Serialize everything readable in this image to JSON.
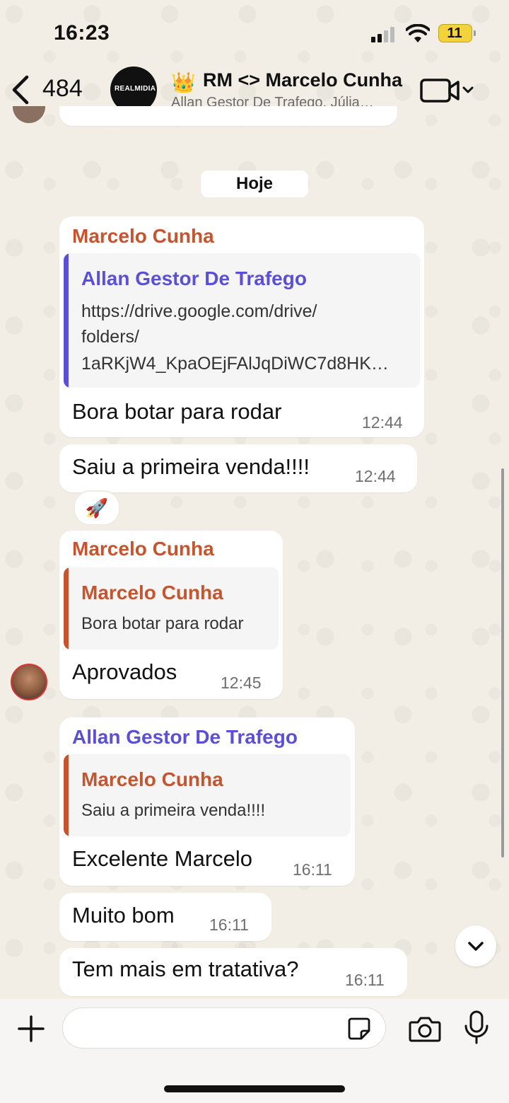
{
  "status_bar": {
    "time": "16:23",
    "battery": "11"
  },
  "header": {
    "back_count": "484",
    "avatar_text": "REALMIDIA",
    "crown": "👑",
    "title": "RM <> Marcelo Cunha",
    "subtitle": "Allan Gestor De Trafego, Júlia…"
  },
  "date_separator": "Hoje",
  "messages": [
    {
      "sender": "Marcelo Cunha",
      "quote_sender": "Allan Gestor De Trafego",
      "quote_lines": [
        "https://drive.google.com/drive/",
        "folders/",
        "1aRKjW4_KpaOEjFAlJqDiWC7d8HK…"
      ],
      "text": "Bora botar para rodar",
      "time": "12:44"
    },
    {
      "text": "Saiu a primeira venda!!!!",
      "time": "12:44",
      "reaction": "🚀"
    },
    {
      "sender": "Marcelo Cunha",
      "quote_sender": "Marcelo Cunha",
      "quote_text": "Bora botar para rodar",
      "text": "Aprovados",
      "time": "12:45"
    },
    {
      "sender": "Allan Gestor De Trafego",
      "quote_sender": "Marcelo Cunha",
      "quote_text": "Saiu a primeira venda!!!!",
      "text": "Excelente Marcelo",
      "time": "16:11"
    },
    {
      "text": "Muito bom",
      "time": "16:11"
    },
    {
      "text": "Tem mais em tratativa?",
      "time": "16:11"
    }
  ],
  "colors": {
    "marcelo": "#c4552e",
    "allan": "#5b4fd6",
    "background": "#efeae2"
  }
}
